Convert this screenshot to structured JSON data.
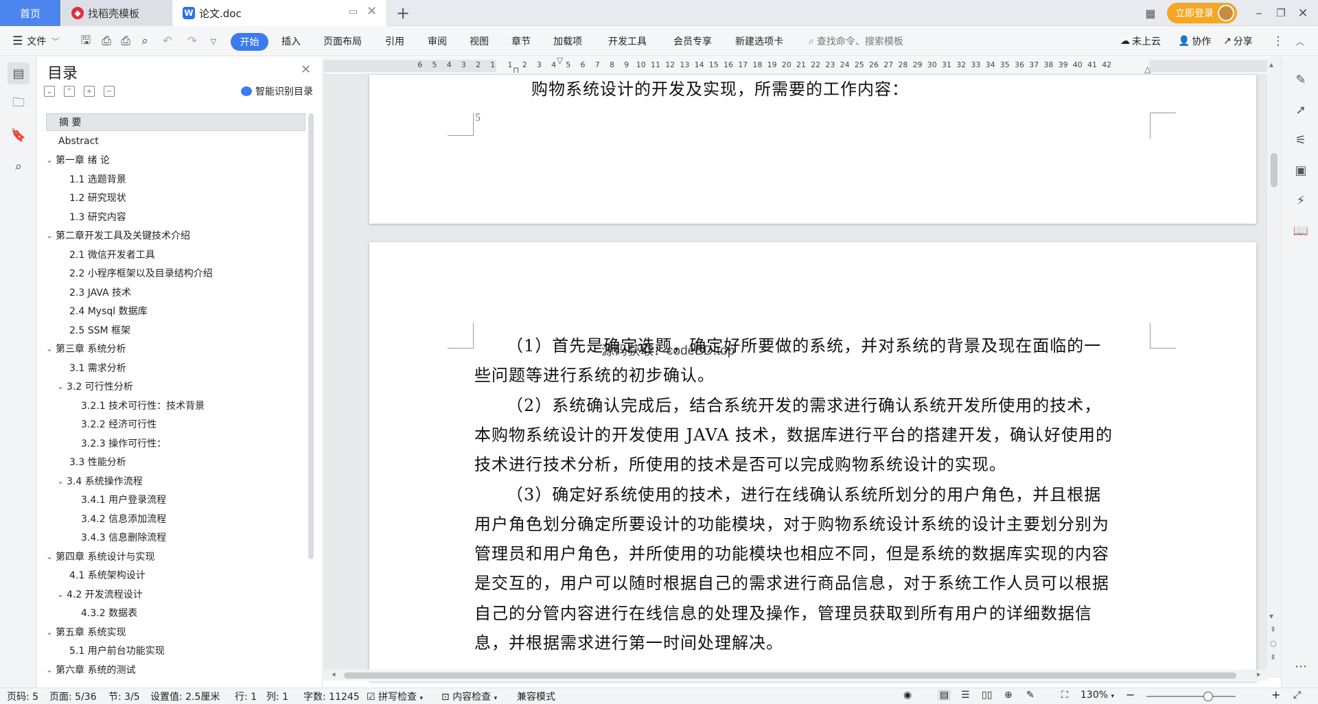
{
  "titlebar": {
    "home_tab": "首页",
    "template_tab": "找稻壳模板",
    "doc_tab": "论文.doc",
    "login_label": "立即登录"
  },
  "toolbar": {
    "file_menu": "文件",
    "tabs": [
      "开始",
      "插入",
      "页面布局",
      "引用",
      "审阅",
      "视图",
      "章节",
      "加载项",
      "开发工具",
      "会员专享",
      "新建选项卡"
    ],
    "search_placeholder": "查找命令、搜索模板",
    "cloud_label": "未上云",
    "collab_label": "协作",
    "share_label": "分享"
  },
  "toc": {
    "title": "目录",
    "smart_label": "智能识别目录",
    "items": [
      {
        "label": "摘    要",
        "level": 1,
        "caret": "",
        "selected": true
      },
      {
        "label": "Abstract",
        "level": 1,
        "caret": ""
      },
      {
        "label": "第一章  绪  论",
        "level": 1,
        "caret": "v"
      },
      {
        "label": "1.1 选题背景",
        "level": 2,
        "caret": ""
      },
      {
        "label": "1.2 研究现状",
        "level": 2,
        "caret": ""
      },
      {
        "label": "1.3 研究内容",
        "level": 2,
        "caret": ""
      },
      {
        "label": "第二章开发工具及关键技术介绍",
        "level": 1,
        "caret": "v"
      },
      {
        "label": "2.1 微信开发者工具",
        "level": 2,
        "caret": ""
      },
      {
        "label": "2.2 小程序框架以及目录结构介绍",
        "level": 2,
        "caret": ""
      },
      {
        "label": "2.3 JAVA 技术",
        "level": 2,
        "caret": ""
      },
      {
        "label": "2.4    Mysql 数据库",
        "level": 2,
        "caret": ""
      },
      {
        "label": "2.5 SSM 框架",
        "level": 2,
        "caret": ""
      },
      {
        "label": "第三章  系统分析",
        "level": 1,
        "caret": "v"
      },
      {
        "label": "3.1 需求分析",
        "level": 2,
        "caret": ""
      },
      {
        "label": "3.2 可行性分析",
        "level": 2,
        "caret": "v"
      },
      {
        "label": "3.2.1 技术可行性：技术背景",
        "level": 3,
        "caret": ""
      },
      {
        "label": "3.2.2 经济可行性",
        "level": 3,
        "caret": ""
      },
      {
        "label": "3.2.3 操作可行性：",
        "level": 3,
        "caret": ""
      },
      {
        "label": "3.3 性能分析",
        "level": 2,
        "caret": ""
      },
      {
        "label": "3.4 系统操作流程",
        "level": 2,
        "caret": "v"
      },
      {
        "label": "3.4.1 用户登录流程",
        "level": 3,
        "caret": ""
      },
      {
        "label": "3.4.2 信息添加流程",
        "level": 3,
        "caret": ""
      },
      {
        "label": "3.4.3 信息删除流程",
        "level": 3,
        "caret": ""
      },
      {
        "label": "第四章  系统设计与实现",
        "level": 1,
        "caret": "v"
      },
      {
        "label": "4.1 系统架构设计",
        "level": 2,
        "caret": ""
      },
      {
        "label": "4.2 开发流程设计",
        "level": 2,
        "caret": "v"
      },
      {
        "label": "4.3.2 数据表",
        "level": 3,
        "caret": ""
      },
      {
        "label": "第五章  系统实现",
        "level": 1,
        "caret": "v"
      },
      {
        "label": "5.1 用户前台功能实现",
        "level": 2,
        "caret": ""
      },
      {
        "label": "第六章    系统的测试",
        "level": 1,
        "caret": "v"
      }
    ]
  },
  "ruler": {
    "numbers": [
      "6",
      "5",
      "4",
      "3",
      "2",
      "1",
      "1",
      "2",
      "3",
      "4",
      "5",
      "6",
      "7",
      "8",
      "9",
      "10",
      "11",
      "12",
      "13",
      "14",
      "15",
      "16",
      "17",
      "18",
      "19",
      "20",
      "21",
      "22",
      "23",
      "24",
      "25",
      "26",
      "27",
      "28",
      "29",
      "30",
      "31",
      "32",
      "33",
      "34",
      "35",
      "36",
      "37",
      "38",
      "39",
      "40",
      "41",
      "42"
    ]
  },
  "document": {
    "page1_last_line": "购物系统设计的开发及实现，所需要的工作内容：",
    "page1_number": "5",
    "overlap_text": "源码获取：codeBD.top",
    "lines": [
      "（1）首先是确定选题，确定好所要做的系统，并对系统的背景及现在面临的一",
      "些问题等进行系统的初步确认。",
      "（2）系统确认完成后，结合系统开发的需求进行确认系统开发所使用的技术，",
      "本购物系统设计的开发使用 JAVA 技术，数据库进行平台的搭建开发，确认好使用的",
      "技术进行技术分析，所使用的技术是否可以完成购物系统设计的实现。",
      "（3）确定好系统使用的技术，进行在线确认系统所划分的用户角色，并且根据",
      "用户角色划分确定所要设计的功能模块，对于购物系统设计系统的设计主要划分别为",
      "管理员和用户角色，并所使用的功能模块也相应不同，但是系统的数据库实现的内容",
      "是交互的，用户可以随时根据自己的需求进行商品信息，对于系统工作人员可以根据",
      "自己的分管内容进行在线信息的处理及操作，管理员获取到所有用户的详细数据信",
      "息，并根据需求进行第一时间处理解决。"
    ]
  },
  "statusbar": {
    "page_code": "页码: 5",
    "page": "页面: 5/36",
    "section": "节: 3/5",
    "setting": "设置值: 2.5厘米",
    "row": "行: 1",
    "col": "列: 1",
    "word_count": "字数: 11245",
    "spell_check": "拼写检查",
    "content_check": "内容检查",
    "compat_mode": "兼容模式",
    "zoom": "130%"
  }
}
